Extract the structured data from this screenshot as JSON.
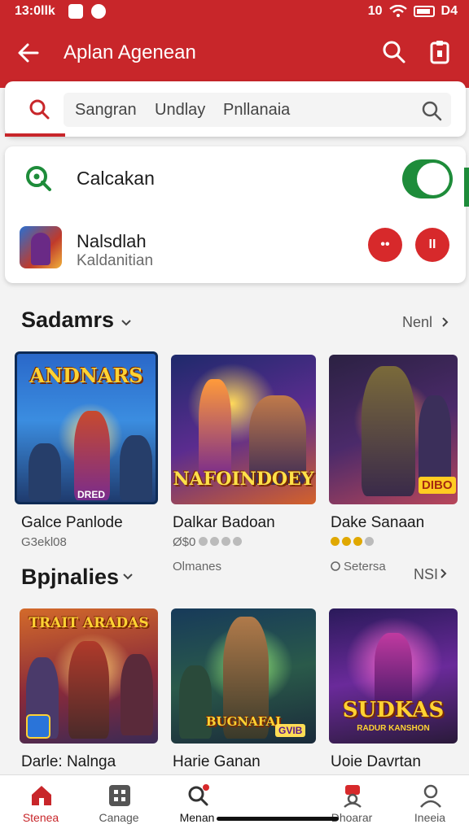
{
  "status": {
    "time": "13:0llk",
    "right_text": "10",
    "battery_text": "D4"
  },
  "appbar": {
    "title": "Aplan Agenean"
  },
  "search": {
    "chips": [
      "Sangran",
      "Undlay",
      "Pnllanaia"
    ]
  },
  "settings": {
    "toggle_label": "Calcakan",
    "toggle_on": true,
    "account_name": "Nalsdlah",
    "account_sub": "Kaldanitian",
    "btn1": "••",
    "btn2": "II"
  },
  "section1": {
    "title": "Sadamrs",
    "more": "Nenl",
    "games": [
      {
        "art_title": "ANDNARS",
        "art_sub": "DRED",
        "title": "Galce Panlode",
        "sub": "G3ekl08"
      },
      {
        "art_title": "NAFOINDOEY",
        "title": "Dalkar Badoan",
        "sub": "Ø$0",
        "rating_dots": [
          "#bbbbbb",
          "#bbbbbb",
          "#bbbbbb",
          "#bbbbbb"
        ],
        "sub2": "Olmanes"
      },
      {
        "art_title": "",
        "art_badge": "DIBO",
        "title": "Dake Sanaan",
        "sub": "",
        "rating_dots": [
          "#e0a800",
          "#e0a800",
          "#e0a800",
          "#bbbbbb"
        ],
        "sub2": "Setersa",
        "more": "NSI"
      }
    ]
  },
  "section2": {
    "title": "Bpjnalies",
    "games": [
      {
        "art_title": "TRAIT ARADAS",
        "title": "Darle: Nalnga"
      },
      {
        "art_title": "BUGNAFAI",
        "art_badge": "GVIB",
        "title": "Harie Ganan"
      },
      {
        "art_title": "SUDKAS",
        "art_sub": "RADUR KANSHON",
        "title": "Uoie Davrtan"
      }
    ]
  },
  "nav": [
    {
      "label": "Stenea",
      "icon": "home-icon",
      "active": true
    },
    {
      "label": "Canage",
      "icon": "grid-icon"
    },
    {
      "label": "Menan",
      "icon": "search-icon"
    },
    {
      "label": "Dhoarar",
      "icon": "profile-badge-icon"
    },
    {
      "label": "Ineeia",
      "icon": "person-icon"
    }
  ],
  "colors": {
    "brand": "#c8262a",
    "toggle_on": "#1e8c3a",
    "action_red": "#d7292b"
  }
}
